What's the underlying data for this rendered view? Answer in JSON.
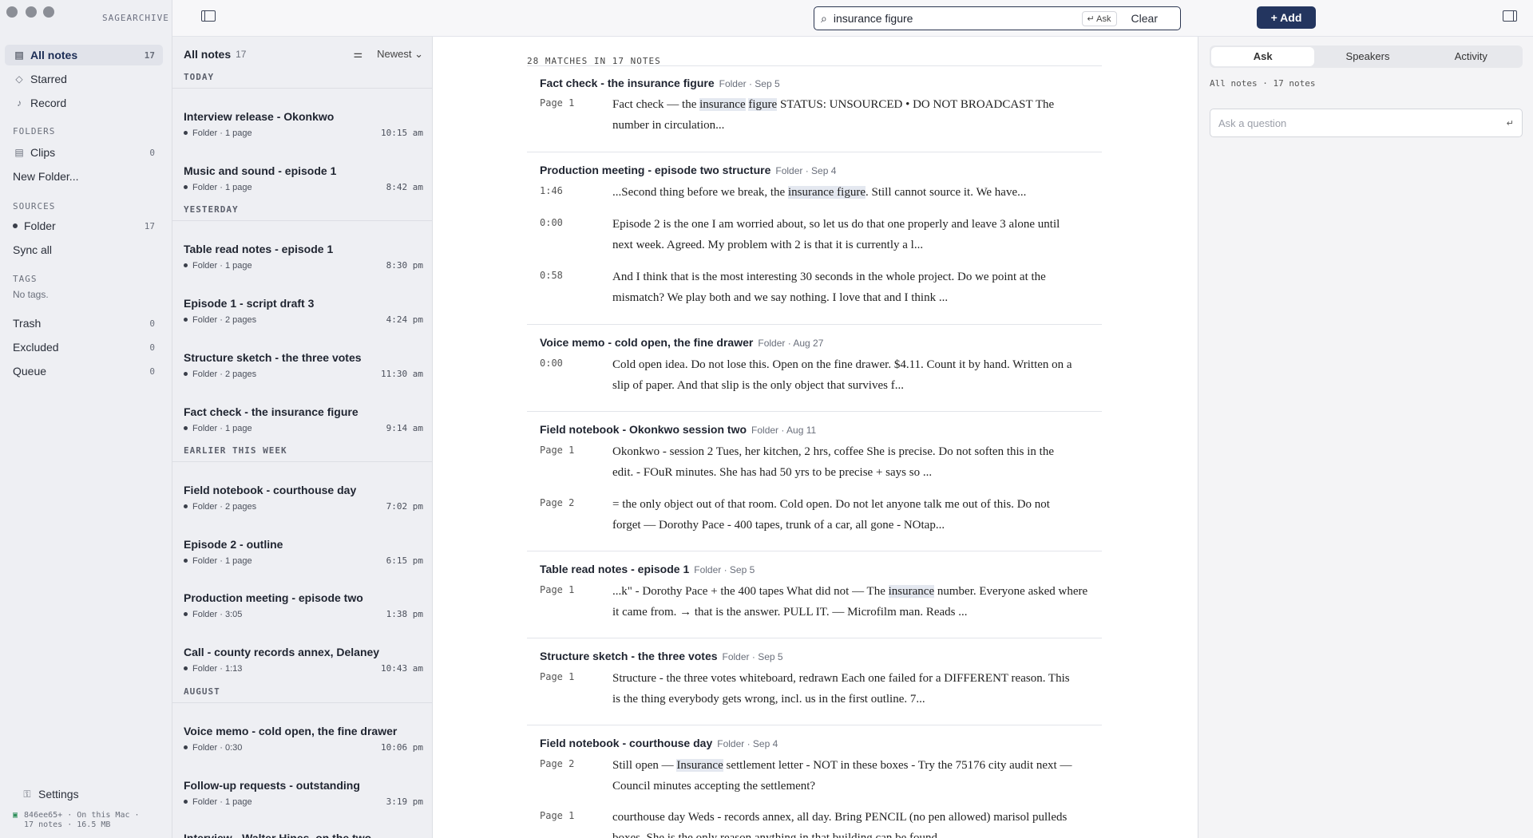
{
  "app": {
    "brand": "SAGEARCHIVE"
  },
  "sidebar": {
    "nav": [
      {
        "label": "All notes",
        "count": "17",
        "icon": "archive-icon"
      },
      {
        "label": "Starred",
        "icon": "tag-icon"
      },
      {
        "label": "Record",
        "icon": "mic-icon"
      }
    ],
    "folders_heading": "FOLDERS",
    "folders": [
      {
        "label": "Clips",
        "count": "0"
      }
    ],
    "new_folder": "New Folder...",
    "sources_heading": "SOURCES",
    "sources": [
      {
        "label": "Folder",
        "count": "17"
      }
    ],
    "sync_all": "Sync all",
    "tags_heading": "TAGS",
    "no_tags": "No tags.",
    "system": [
      {
        "label": "Trash",
        "count": "0"
      },
      {
        "label": "Excluded",
        "count": "0"
      },
      {
        "label": "Queue",
        "count": "0"
      }
    ],
    "settings": "Settings",
    "footer_line1": "846ee65+ · On this Mac ·",
    "footer_line2": "17 notes · 16.5 MB"
  },
  "search": {
    "value": "insurance figure",
    "ask_hint": "↵ Ask",
    "clear": "Clear"
  },
  "toolbar": {
    "add": "+ Add"
  },
  "list": {
    "title": "All notes",
    "count": "17",
    "sort": "Newest ⌄",
    "groups": [
      {
        "label": "TODAY",
        "notes": [
          {
            "title": "Interview release - Okonkwo",
            "meta": "Folder · 1 page",
            "time": "10:15 am"
          },
          {
            "title": "Music and sound - episode 1",
            "meta": "Folder · 1 page",
            "time": "8:42 am"
          }
        ]
      },
      {
        "label": "YESTERDAY",
        "notes": [
          {
            "title": "Table read notes - episode 1",
            "meta": "Folder · 1 page",
            "time": "8:30 pm"
          },
          {
            "title": "Episode 1 - script draft 3",
            "meta": "Folder · 2 pages",
            "time": "4:24 pm"
          },
          {
            "title": "Structure sketch - the three votes",
            "meta": "Folder · 2 pages",
            "time": "11:30 am"
          },
          {
            "title": "Fact check - the insurance figure",
            "meta": "Folder · 1 page",
            "time": "9:14 am"
          }
        ]
      },
      {
        "label": "EARLIER THIS WEEK",
        "notes": [
          {
            "title": "Field notebook - courthouse day",
            "meta": "Folder · 2 pages",
            "time": "7:02 pm"
          },
          {
            "title": "Episode 2 - outline",
            "meta": "Folder · 1 page",
            "time": "6:15 pm"
          },
          {
            "title": "Production meeting - episode two",
            "meta": "Folder · 3:05",
            "time": "1:38 pm"
          },
          {
            "title": "Call - county records annex, Delaney",
            "meta": "Folder · 1:13",
            "time": "10:43 am"
          }
        ]
      },
      {
        "label": "AUGUST",
        "notes": [
          {
            "title": "Voice memo - cold open, the fine drawer",
            "meta": "Folder · 0:30",
            "time": "10:06 pm"
          },
          {
            "title": "Follow-up requests - outstanding",
            "meta": "Folder · 1 page",
            "time": "3:19 pm"
          },
          {
            "title": "Interview - Walter Hines, on the two",
            "meta": "",
            "time": ""
          }
        ]
      }
    ]
  },
  "results": {
    "summary": "28 MATCHES IN 17 NOTES",
    "items": [
      {
        "title": "Fact check - the insurance figure",
        "meta": "Folder · Sep 5",
        "snippets": [
          {
            "label": "Page 1",
            "pre": "Fact check — the ",
            "hl": "insurance",
            "mid": " ",
            "hl2": "figure",
            "post": " STATUS: UNSOURCED • DO NOT BROADCAST The number in circulation..."
          }
        ]
      },
      {
        "title": "Production meeting - episode two structure",
        "meta": "Folder · Sep 4",
        "snippets": [
          {
            "label": "1:46",
            "pre": "...Second thing before we break, the ",
            "hl": "insurance figure",
            "post": ". Still cannot source it. We have..."
          },
          {
            "label": "0:00",
            "pre": "Episode 2 is the one I am worried about, so let us do that one properly and leave 3 alone until next week. Agreed. My problem with 2 is that it is currently a l..."
          },
          {
            "label": "0:58",
            "pre": "And I think that is the most interesting 30 seconds in the whole project. Do we point at the mismatch? We play both and we say nothing. I love that and I think ..."
          }
        ]
      },
      {
        "title": "Voice memo - cold open, the fine drawer",
        "meta": "Folder · Aug 27",
        "snippets": [
          {
            "label": "0:00",
            "pre": "Cold open idea. Do not lose this. Open on the fine drawer. $4.11. Count it by hand. Written on a slip of paper. And that slip is the only object that survives f..."
          }
        ]
      },
      {
        "title": "Field notebook - Okonkwo session two",
        "meta": "Folder · Aug 11",
        "snippets": [
          {
            "label": "Page 1",
            "pre": "Okonkwo - session 2 Tues, her kitchen, 2 hrs, coffee She is precise. Do not soften this in the edit. - FOuR minutes. She has had 50 yrs to be precise + says so ..."
          },
          {
            "label": "Page 2",
            "pre": "= the only object out of that room. Cold open. Do not let anyone talk me out of this. Do not forget — Dorothy Pace - 400 tapes, trunk of a car, all gone - NOtap..."
          }
        ]
      },
      {
        "title": "Table read notes - episode 1",
        "meta": "Folder · Sep 5",
        "snippets": [
          {
            "label": "Page 1",
            "pre": "...k\" - Dorothy Pace + the 400 tapes What did not — The ",
            "hl": "insurance",
            "post": " number. Everyone asked where it came from. → that is the answer. PULL IT. — Microfilm man. Reads ..."
          }
        ]
      },
      {
        "title": "Structure sketch - the three votes",
        "meta": "Folder · Sep 5",
        "snippets": [
          {
            "label": "Page 1",
            "pre": "Structure - the three votes whiteboard, redrawn Each one failed for a DIFFERENT reason. This is the thing everybody gets wrong, incl. us in the first outline. 7..."
          }
        ]
      },
      {
        "title": "Field notebook - courthouse day",
        "meta": "Folder · Sep 4",
        "snippets": [
          {
            "label": "Page 2",
            "pre": "Still open — ",
            "hl": "Insurance",
            "post": " settlement letter - NOT in these boxes - Try the 75176 city audit next — Council minutes accepting the settlement?"
          },
          {
            "label": "Page 1",
            "pre": "courthouse day Weds - records annex, all day. Bring PENCIL (no pen allowed) marisol pulleds boxes. She is the only reason anything in that building can be found"
          }
        ]
      }
    ]
  },
  "rpanel": {
    "tabs": [
      "Ask",
      "Speakers",
      "Activity"
    ],
    "scope": "All notes · 17 notes",
    "ask_placeholder": "Ask a question"
  }
}
